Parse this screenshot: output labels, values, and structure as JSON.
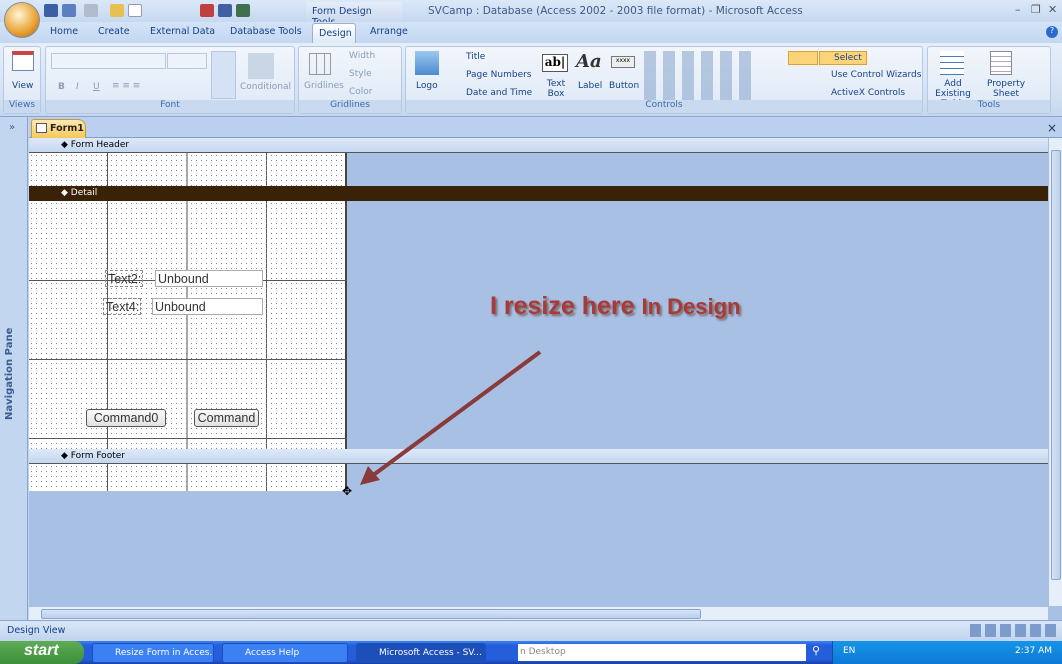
{
  "window": {
    "title": "SVCamp : Database (Access 2002 - 2003 file format) - Microsoft Access",
    "context_tab": "Form Design Tools",
    "min": "–",
    "restore": "❐",
    "close": "✕",
    "help": "?"
  },
  "tabs": [
    "Home",
    "Create",
    "External Data",
    "Database Tools",
    "Design",
    "Arrange"
  ],
  "ribbon": {
    "views": {
      "label": "Views",
      "view": "View"
    },
    "font": {
      "label": "Font",
      "bold": "B",
      "italic": "I",
      "underline": "U",
      "conditional": "Conditional"
    },
    "gridlines": {
      "label": "Gridlines",
      "gridlines": "Gridlines",
      "width": "Width",
      "style": "Style",
      "color": "Color"
    },
    "controls": {
      "label": "Controls",
      "logo": "Logo",
      "title": "Title",
      "page_numbers": "Page Numbers",
      "date_time": "Date and Time",
      "text_box": "Text Box",
      "text_box_icon": "ab|",
      "label_btn": "Label",
      "label_icon": "Aa",
      "button": "Button",
      "button_icon": "xxxx",
      "select": "Select",
      "wizards": "Use Control Wizards",
      "activex": "ActiveX Controls"
    },
    "tools": {
      "label": "Tools",
      "add_fields": "Add Existing Fields",
      "property_sheet": "Property Sheet"
    }
  },
  "nav": {
    "label": "Navigation Pane",
    "toggle": "»"
  },
  "document": {
    "tab": "Form1",
    "close": "×"
  },
  "form": {
    "header": "Form Header",
    "detail": "Detail",
    "footer": "Form Footer",
    "controls": {
      "text2_label": "Text2:",
      "text2_value": "Unbound",
      "text4_label": "Text4:",
      "text4_value": "Unbound",
      "command0": "Command0",
      "command1": "Command"
    }
  },
  "annotation": {
    "main": "I resize here",
    "tail": "In Design"
  },
  "status": {
    "view": "Design View"
  },
  "taskbar": {
    "start": "start",
    "items": [
      "Resize Form in Acces...",
      "Access Help",
      "Microsoft Access - SV..."
    ],
    "search": "n Desktop",
    "lang": "EN",
    "time": "2:37 AM"
  },
  "colors": {
    "detail_bar": "#3a2208",
    "annotation": "#a83a3a",
    "taskbar": "#245edb"
  }
}
